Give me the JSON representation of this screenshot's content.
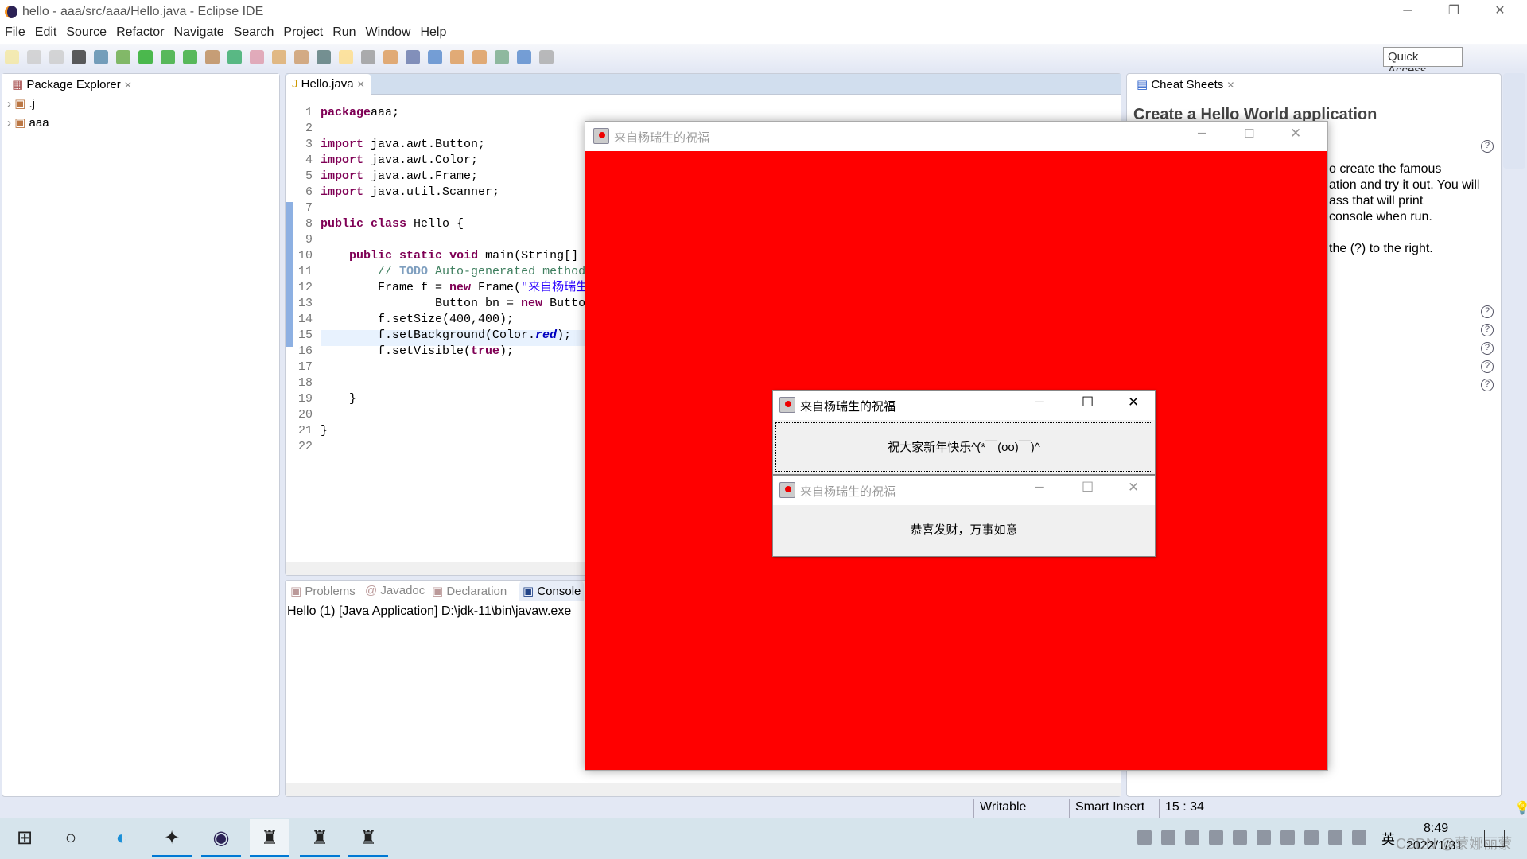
{
  "window": {
    "title": "hello - aaa/src/aaa/Hello.java - Eclipse IDE",
    "minimize": "─",
    "restore": "❐",
    "close": "✕"
  },
  "menu": [
    "File",
    "Edit",
    "Source",
    "Refactor",
    "Navigate",
    "Search",
    "Project",
    "Run",
    "Window",
    "Help"
  ],
  "toolbar": {
    "quick_access": "Quick Access"
  },
  "package_explorer": {
    "title": "Package Explorer",
    "items": [
      ".j",
      "aaa"
    ]
  },
  "editor": {
    "tab": "Hello.java",
    "line_numbers": [
      "1",
      "2",
      "3",
      "4",
      "5",
      "6",
      "7",
      "8",
      "9",
      "10",
      "11",
      "12",
      "13",
      "14",
      "15",
      "16",
      "17",
      "18",
      "19",
      "20",
      "21",
      "22"
    ],
    "lines": [
      [
        [
          "kw",
          "package"
        ],
        [
          "",
          "aaa;"
        ]
      ],
      [],
      [
        [
          "kw",
          "import"
        ],
        [
          "",
          " java.awt.Button;"
        ]
      ],
      [
        [
          "kw",
          "import"
        ],
        [
          "",
          " java.awt.Color;"
        ]
      ],
      [
        [
          "kw",
          "import"
        ],
        [
          "",
          " java.awt.Frame;"
        ]
      ],
      [
        [
          "kw",
          "import"
        ],
        [
          "",
          " java.util.Scanner;"
        ]
      ],
      [],
      [
        [
          "kw",
          "public"
        ],
        [
          "",
          " "
        ],
        [
          "kw",
          "class"
        ],
        [
          "",
          " Hello {"
        ]
      ],
      [],
      [
        [
          "",
          "    "
        ],
        [
          "kw",
          "public"
        ],
        [
          "",
          " "
        ],
        [
          "kw",
          "static"
        ],
        [
          "",
          " "
        ],
        [
          "kw",
          "void"
        ],
        [
          "",
          " main(String[]"
        ]
      ],
      [
        [
          "",
          "        "
        ],
        [
          "cm",
          "// "
        ],
        [
          "todo",
          "TODO"
        ],
        [
          "cm",
          " Auto-generated method"
        ]
      ],
      [
        [
          "",
          "        Frame f = "
        ],
        [
          "kw",
          "new"
        ],
        [
          "",
          " Frame("
        ],
        [
          "str",
          "\"来自杨瑞生"
        ]
      ],
      [
        [
          "",
          "                Button bn = "
        ],
        [
          "kw",
          "new"
        ],
        [
          "",
          " Butto"
        ]
      ],
      [
        [
          "",
          "        f.setSize(400,400);"
        ]
      ],
      [
        [
          "",
          "        f.setBackground(Color."
        ],
        [
          "it",
          "red"
        ],
        [
          "",
          ");"
        ]
      ],
      [
        [
          "",
          "        f.setVisible("
        ],
        [
          "kw",
          "true"
        ],
        [
          "",
          ");"
        ]
      ],
      [],
      [],
      [
        [
          "",
          "    }"
        ]
      ],
      [],
      [
        [
          "",
          "}"
        ]
      ],
      []
    ]
  },
  "bottom_panel": {
    "tabs": [
      "Problems",
      "Javadoc",
      "Declaration",
      "Console"
    ],
    "console_text": "Hello (1) [Java Application] D:\\jdk-11\\bin\\javaw.exe"
  },
  "cheat_sheets": {
    "title": "Cheat Sheets",
    "heading": "Create a Hello World application",
    "visible_lines": [
      "o create the famous",
      "ation and try it out. You will",
      "ass that will print",
      "console when run.",
      "the (?) to the right."
    ]
  },
  "status_bar": {
    "writable": "Writable",
    "insert_mode": "Smart Insert",
    "position": "15 : 34"
  },
  "awt_frame": {
    "title": "来自杨瑞生的祝福",
    "background": "#ff0000"
  },
  "dialogs": [
    {
      "title": "来自杨瑞生的祝福",
      "button": "祝大家新年快乐^(*￣(oo)￣)^",
      "active": true
    },
    {
      "title": "来自杨瑞生的祝福",
      "button": "恭喜发财，万事如意",
      "active": false
    }
  ],
  "taskbar": {
    "apps": [
      "windows-start-icon",
      "search-circle-icon",
      "edge-icon",
      "game-icon",
      "eclipse-icon",
      "java-app-icon",
      "java-app-icon",
      "java-app-icon"
    ],
    "ime": "英",
    "time": "8:49",
    "date": "2022/1/31",
    "watermark": "CSDN @蒙娜丽蒙"
  },
  "colors": {
    "accent": "#0078d4",
    "keyword": "#7f0055",
    "string": "#2a00ff"
  }
}
